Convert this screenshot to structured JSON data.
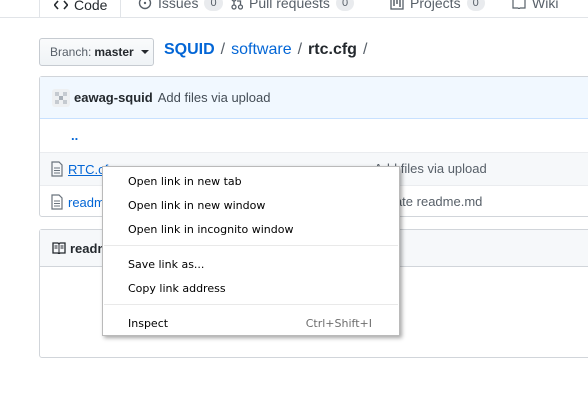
{
  "tabs": [
    {
      "label": "Code"
    },
    {
      "label": "Issues",
      "count": "0"
    },
    {
      "label": "Pull requests",
      "count": "0"
    },
    {
      "label": "Projects",
      "count": "0"
    },
    {
      "label": "Wiki"
    }
  ],
  "branch": {
    "prefix": "Branch:",
    "name": "master"
  },
  "breadcrumb": {
    "repo": "SQUID",
    "sep1": "/",
    "folder": "software",
    "sep2": "/",
    "current": "rtc.cfg",
    "sep3": "/"
  },
  "commit": {
    "author": "eawag-squid",
    "message": "Add files via upload"
  },
  "files": {
    "updir": "..",
    "rows": [
      {
        "name": "RTC.cfg",
        "commit": "Add files via upload"
      },
      {
        "name": "readme.md",
        "commit": "Create readme.md"
      }
    ]
  },
  "readme": {
    "title": "readme.md"
  },
  "context_menu": {
    "items": [
      {
        "label": "Open link in new tab"
      },
      {
        "label": "Open link in new window"
      },
      {
        "label": "Open link in incognito window"
      },
      {
        "label": "Save link as..."
      },
      {
        "label": "Copy link address"
      },
      {
        "label": "Inspect",
        "shortcut": "Ctrl+Shift+I"
      }
    ]
  },
  "colors": {
    "link": "#0366d6",
    "tab_accent": "#e36209",
    "commit_bar": "#f1f8ff"
  }
}
